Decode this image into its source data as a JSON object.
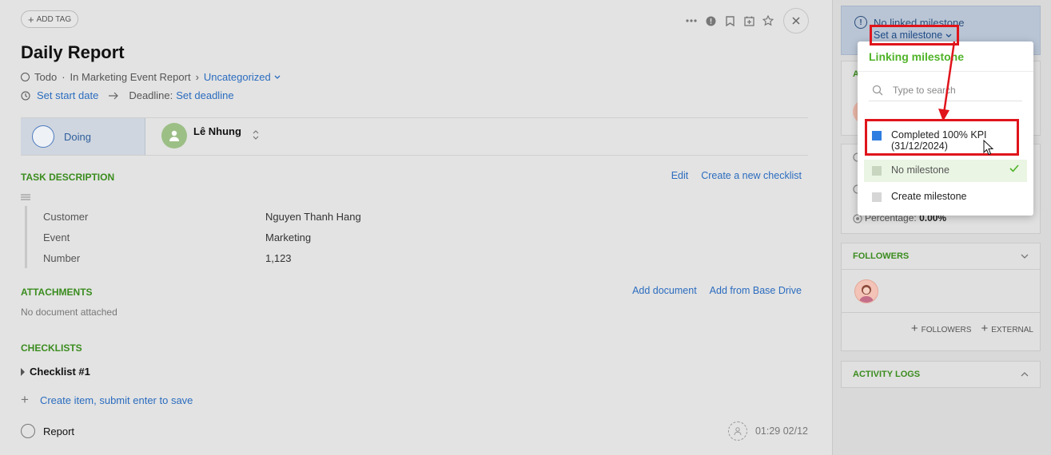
{
  "task": {
    "add_tag": "ADD TAG",
    "title": "Daily Report",
    "breadcrumb": {
      "status": "Todo",
      "sep": "·",
      "project": "In Marketing Event Report",
      "arrow": "›",
      "category": "Uncategorized"
    },
    "dates": {
      "start_link": "Set start date",
      "deadline_label": "Deadline:",
      "deadline_link": "Set deadline"
    },
    "status_label": "Doing",
    "assignee": "Lê Nhung",
    "description": {
      "heading": "TASK DESCRIPTION",
      "edit": "Edit",
      "create_checklist": "Create a new checklist",
      "fields": [
        {
          "key": "Customer",
          "value": "Nguyen Thanh Hang"
        },
        {
          "key": "Event",
          "value": "Marketing"
        },
        {
          "key": "Number",
          "value": "1,123"
        }
      ]
    },
    "attachments": {
      "heading": "ATTACHMENTS",
      "add_document": "Add document",
      "add_drive": "Add from Base Drive",
      "empty": "No document attached"
    },
    "checklists": {
      "heading": "CHECKLISTS",
      "name": "Checklist #1",
      "create_item": "Create item, submit enter to save",
      "item": "Report",
      "item_time": "01:29 02/12"
    }
  },
  "sidebar": {
    "milestone_status": "No linked milestone",
    "set_milestone": "Set a milestone",
    "card1_letter": "A",
    "percentage_label": "Percentage:",
    "percentage_value": "0.00%",
    "followers": {
      "heading": "FOLLOWERS",
      "add_followers": "FOLLOWERS",
      "add_external": "EXTERNAL"
    },
    "activity_logs": "ACTIVITY LOGS"
  },
  "dropdown": {
    "title": "Linking milestone",
    "search_placeholder": "Type to search",
    "items": [
      {
        "label": "Completed 100% KPI",
        "sub": "(31/12/2024)",
        "color": "#2f7de1"
      },
      {
        "label": "No milestone",
        "color": "#c8d6c0"
      },
      {
        "label": "Create milestone",
        "color": "#d6d6d6"
      }
    ]
  },
  "colors": {
    "accent_green": "#4fb327",
    "link_blue": "#2b6cbf",
    "highlight_red": "#e0141b"
  }
}
